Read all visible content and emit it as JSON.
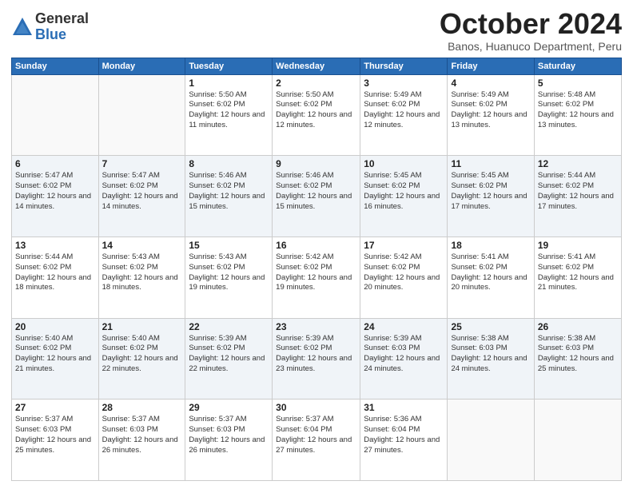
{
  "logo": {
    "general": "General",
    "blue": "Blue"
  },
  "header": {
    "month": "October 2024",
    "location": "Banos, Huanuco Department, Peru"
  },
  "weekdays": [
    "Sunday",
    "Monday",
    "Tuesday",
    "Wednesday",
    "Thursday",
    "Friday",
    "Saturday"
  ],
  "weeks": [
    [
      {
        "day": "",
        "info": ""
      },
      {
        "day": "",
        "info": ""
      },
      {
        "day": "1",
        "info": "Sunrise: 5:50 AM\nSunset: 6:02 PM\nDaylight: 12 hours and 11 minutes."
      },
      {
        "day": "2",
        "info": "Sunrise: 5:50 AM\nSunset: 6:02 PM\nDaylight: 12 hours and 12 minutes."
      },
      {
        "day": "3",
        "info": "Sunrise: 5:49 AM\nSunset: 6:02 PM\nDaylight: 12 hours and 12 minutes."
      },
      {
        "day": "4",
        "info": "Sunrise: 5:49 AM\nSunset: 6:02 PM\nDaylight: 12 hours and 13 minutes."
      },
      {
        "day": "5",
        "info": "Sunrise: 5:48 AM\nSunset: 6:02 PM\nDaylight: 12 hours and 13 minutes."
      }
    ],
    [
      {
        "day": "6",
        "info": "Sunrise: 5:47 AM\nSunset: 6:02 PM\nDaylight: 12 hours and 14 minutes."
      },
      {
        "day": "7",
        "info": "Sunrise: 5:47 AM\nSunset: 6:02 PM\nDaylight: 12 hours and 14 minutes."
      },
      {
        "day": "8",
        "info": "Sunrise: 5:46 AM\nSunset: 6:02 PM\nDaylight: 12 hours and 15 minutes."
      },
      {
        "day": "9",
        "info": "Sunrise: 5:46 AM\nSunset: 6:02 PM\nDaylight: 12 hours and 15 minutes."
      },
      {
        "day": "10",
        "info": "Sunrise: 5:45 AM\nSunset: 6:02 PM\nDaylight: 12 hours and 16 minutes."
      },
      {
        "day": "11",
        "info": "Sunrise: 5:45 AM\nSunset: 6:02 PM\nDaylight: 12 hours and 17 minutes."
      },
      {
        "day": "12",
        "info": "Sunrise: 5:44 AM\nSunset: 6:02 PM\nDaylight: 12 hours and 17 minutes."
      }
    ],
    [
      {
        "day": "13",
        "info": "Sunrise: 5:44 AM\nSunset: 6:02 PM\nDaylight: 12 hours and 18 minutes."
      },
      {
        "day": "14",
        "info": "Sunrise: 5:43 AM\nSunset: 6:02 PM\nDaylight: 12 hours and 18 minutes."
      },
      {
        "day": "15",
        "info": "Sunrise: 5:43 AM\nSunset: 6:02 PM\nDaylight: 12 hours and 19 minutes."
      },
      {
        "day": "16",
        "info": "Sunrise: 5:42 AM\nSunset: 6:02 PM\nDaylight: 12 hours and 19 minutes."
      },
      {
        "day": "17",
        "info": "Sunrise: 5:42 AM\nSunset: 6:02 PM\nDaylight: 12 hours and 20 minutes."
      },
      {
        "day": "18",
        "info": "Sunrise: 5:41 AM\nSunset: 6:02 PM\nDaylight: 12 hours and 20 minutes."
      },
      {
        "day": "19",
        "info": "Sunrise: 5:41 AM\nSunset: 6:02 PM\nDaylight: 12 hours and 21 minutes."
      }
    ],
    [
      {
        "day": "20",
        "info": "Sunrise: 5:40 AM\nSunset: 6:02 PM\nDaylight: 12 hours and 21 minutes."
      },
      {
        "day": "21",
        "info": "Sunrise: 5:40 AM\nSunset: 6:02 PM\nDaylight: 12 hours and 22 minutes."
      },
      {
        "day": "22",
        "info": "Sunrise: 5:39 AM\nSunset: 6:02 PM\nDaylight: 12 hours and 22 minutes."
      },
      {
        "day": "23",
        "info": "Sunrise: 5:39 AM\nSunset: 6:02 PM\nDaylight: 12 hours and 23 minutes."
      },
      {
        "day": "24",
        "info": "Sunrise: 5:39 AM\nSunset: 6:03 PM\nDaylight: 12 hours and 24 minutes."
      },
      {
        "day": "25",
        "info": "Sunrise: 5:38 AM\nSunset: 6:03 PM\nDaylight: 12 hours and 24 minutes."
      },
      {
        "day": "26",
        "info": "Sunrise: 5:38 AM\nSunset: 6:03 PM\nDaylight: 12 hours and 25 minutes."
      }
    ],
    [
      {
        "day": "27",
        "info": "Sunrise: 5:37 AM\nSunset: 6:03 PM\nDaylight: 12 hours and 25 minutes."
      },
      {
        "day": "28",
        "info": "Sunrise: 5:37 AM\nSunset: 6:03 PM\nDaylight: 12 hours and 26 minutes."
      },
      {
        "day": "29",
        "info": "Sunrise: 5:37 AM\nSunset: 6:03 PM\nDaylight: 12 hours and 26 minutes."
      },
      {
        "day": "30",
        "info": "Sunrise: 5:37 AM\nSunset: 6:04 PM\nDaylight: 12 hours and 27 minutes."
      },
      {
        "day": "31",
        "info": "Sunrise: 5:36 AM\nSunset: 6:04 PM\nDaylight: 12 hours and 27 minutes."
      },
      {
        "day": "",
        "info": ""
      },
      {
        "day": "",
        "info": ""
      }
    ]
  ]
}
